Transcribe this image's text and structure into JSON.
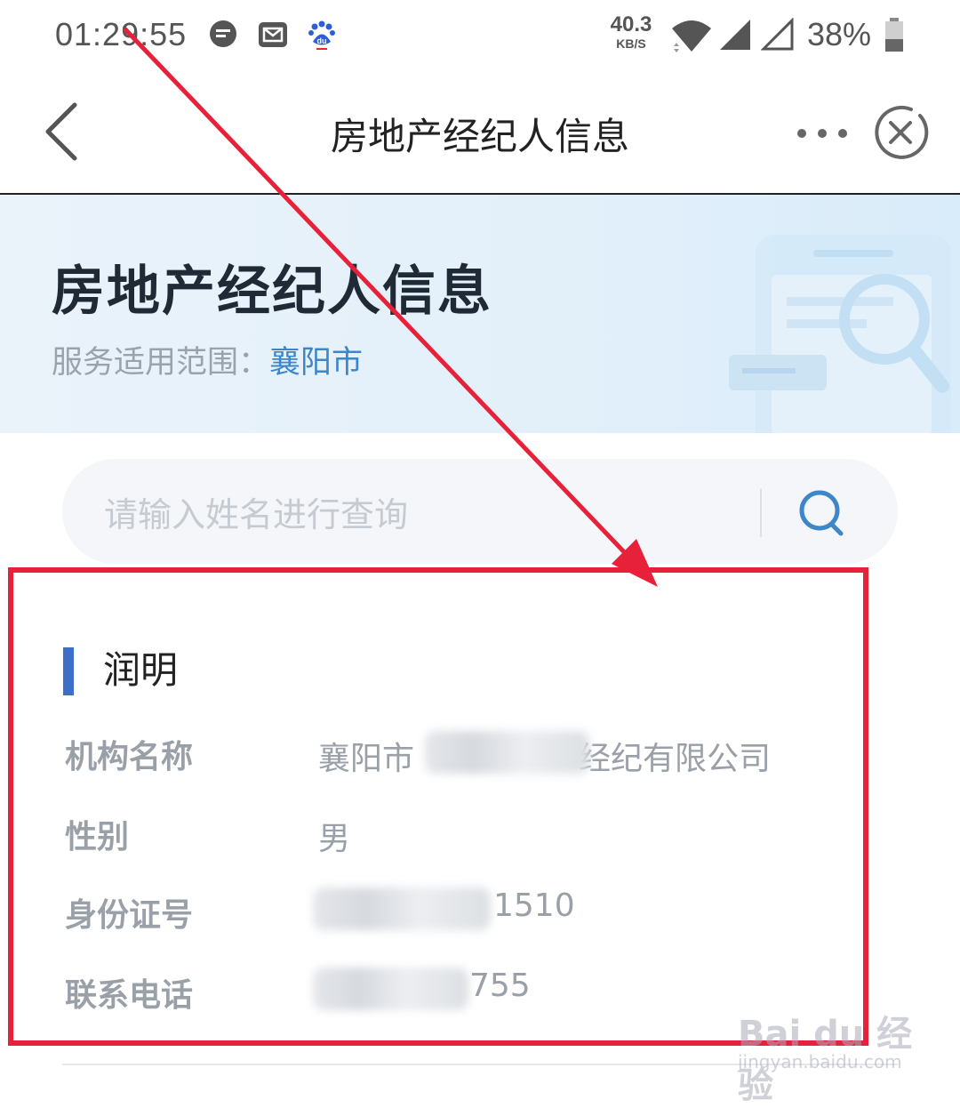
{
  "status_bar": {
    "time": "01:29:55",
    "net_speed_value": "40.3",
    "net_speed_unit": "KB/S",
    "battery_percent": "38%",
    "icons": [
      "message-icon",
      "mail-icon",
      "baidu-paw-icon",
      "wifi-icon",
      "signal-icon",
      "signal-empty-icon",
      "battery-icon"
    ]
  },
  "nav": {
    "title": "房地产经纪人信息",
    "icons": [
      "back-arrow-icon",
      "more-dots-icon",
      "close-circle-icon"
    ]
  },
  "banner": {
    "title": "房地产经纪人信息",
    "scope_label": "服务适用范围：",
    "scope_city": "襄阳市"
  },
  "search": {
    "placeholder": "请输入姓名进行查询",
    "icon": "search-icon"
  },
  "result": {
    "name": "润明",
    "rows": [
      {
        "label": "机构名称",
        "value_prefix": "襄阳市",
        "value_suffix": "经纪有限公司"
      },
      {
        "label": "性别",
        "value": "男"
      },
      {
        "label": "身份证号",
        "value_suffix": "1510"
      },
      {
        "label": "联系电话",
        "value_suffix": "755"
      }
    ]
  },
  "watermark": {
    "brand": "Bai du 经验",
    "site": "jingyan.baidu.com"
  },
  "colors": {
    "accent_blue": "#3d6fc7",
    "city_link": "#3d86c9",
    "annotation_red": "#e8213a"
  }
}
